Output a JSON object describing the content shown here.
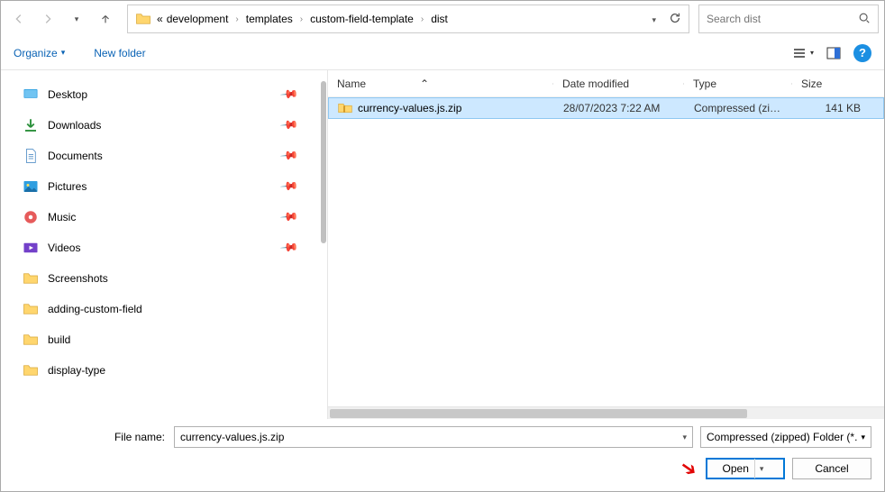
{
  "breadcrumb": {
    "prefix": "«",
    "items": [
      "development",
      "templates",
      "custom-field-template",
      "dist"
    ]
  },
  "search": {
    "placeholder": "Search dist"
  },
  "toolbar": {
    "organize": "Organize",
    "newFolder": "New folder"
  },
  "sidebar": {
    "items": [
      {
        "label": "Desktop",
        "kind": "desktop",
        "pinned": true
      },
      {
        "label": "Downloads",
        "kind": "downloads",
        "pinned": true
      },
      {
        "label": "Documents",
        "kind": "documents",
        "pinned": true
      },
      {
        "label": "Pictures",
        "kind": "pictures",
        "pinned": true
      },
      {
        "label": "Music",
        "kind": "music",
        "pinned": true
      },
      {
        "label": "Videos",
        "kind": "videos",
        "pinned": true
      },
      {
        "label": "Screenshots",
        "kind": "folder",
        "pinned": false
      },
      {
        "label": "adding-custom-field",
        "kind": "folder",
        "pinned": false
      },
      {
        "label": "build",
        "kind": "folder",
        "pinned": false
      },
      {
        "label": "display-type",
        "kind": "folder",
        "pinned": false
      }
    ]
  },
  "columns": {
    "name": "Name",
    "date": "Date modified",
    "type": "Type",
    "size": "Size"
  },
  "files": [
    {
      "name": "currency-values.js.zip",
      "date": "28/07/2023 7:22 AM",
      "type": "Compressed (zipp...",
      "size": "141 KB"
    }
  ],
  "footer": {
    "label": "File name:",
    "value": "currency-values.js.zip",
    "filter": "Compressed (zipped) Folder (*.",
    "open": "Open",
    "cancel": "Cancel"
  }
}
